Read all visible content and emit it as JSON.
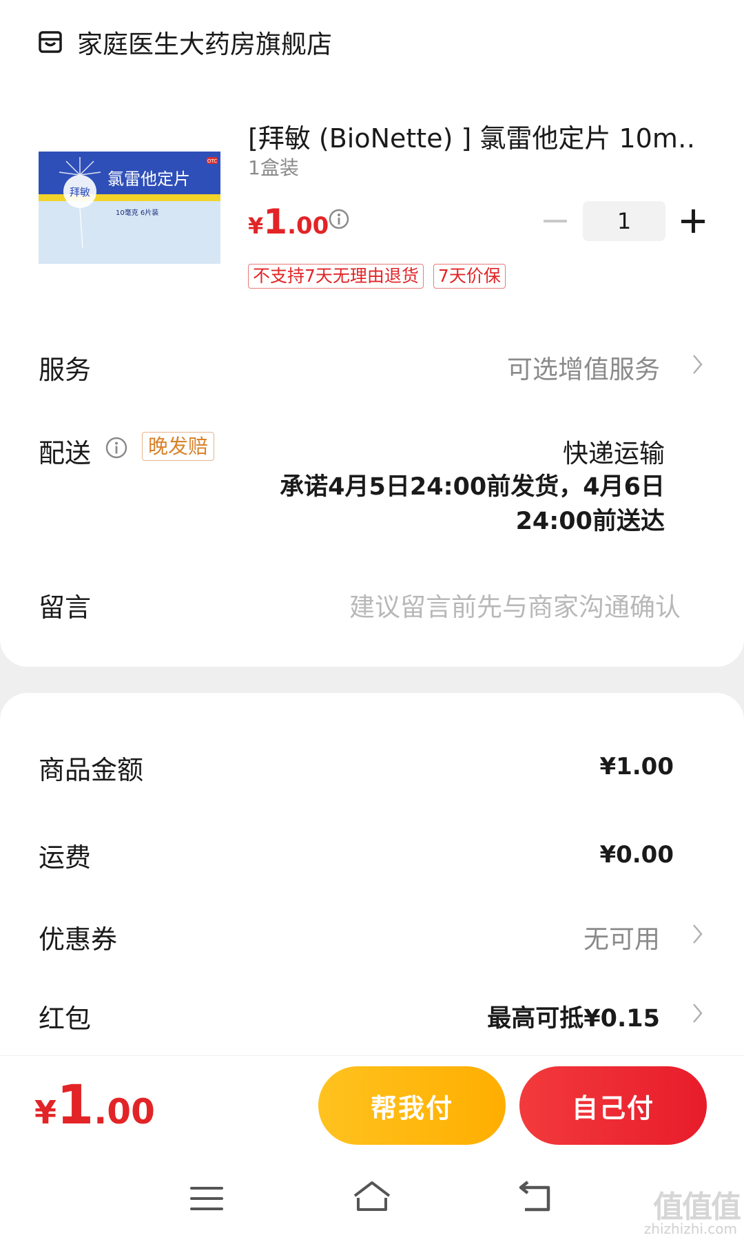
{
  "store": {
    "name": "家庭医生大药房旗舰店",
    "icon": "store-icon"
  },
  "product": {
    "title": "[拜敏 (BioNette) ] 氯雷他定片 10m…",
    "spec": "1盒装",
    "price": {
      "yen": "¥",
      "int": "1",
      "dec": ".00"
    },
    "quantity": "1",
    "tags": [
      "不支持7天无理由退货",
      "7天价保"
    ],
    "image": {
      "brand": "拜敏",
      "drug_name": "氯雷他定片",
      "dose_text": "10毫克 6片装",
      "otc": "OTC"
    }
  },
  "service": {
    "label": "服务",
    "value": "可选增值服务"
  },
  "shipping": {
    "label": "配送",
    "late_tag": "晚发赔",
    "method": "快递运输",
    "promise": "承诺4月5日24:00前发货，4月6日24:00前送达"
  },
  "message": {
    "label": "留言",
    "placeholder": "建议留言前先与商家沟通确认"
  },
  "summary": {
    "goods_label": "商品金额",
    "goods_value": "¥1.00",
    "freight_label": "运费",
    "freight_value": "¥0.00",
    "coupon_label": "优惠券",
    "coupon_value": "无可用",
    "redpacket_label": "红包",
    "redpacket_value": "最高可抵¥0.15"
  },
  "bottom": {
    "total": {
      "yen": "¥",
      "int": "1",
      "dec": ".00"
    },
    "help_pay": "帮我付",
    "self_pay": "自己付"
  },
  "watermark": {
    "main": "值值值",
    "sub": "zhizhizhi.com"
  },
  "colors": {
    "accent_red": "#e22427",
    "yellow_button": "#ffb800",
    "red_button": "#ec2530",
    "late_tag": "#d9822b"
  }
}
